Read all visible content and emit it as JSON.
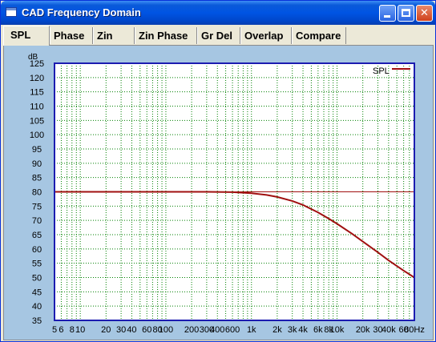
{
  "window": {
    "title": "CAD Frequency Domain"
  },
  "title_buttons": {
    "minimize": "",
    "maximize": "",
    "close": "✕"
  },
  "tabs": [
    {
      "label": "SPL"
    },
    {
      "label": "Phase"
    },
    {
      "label": "Zin"
    },
    {
      "label": "Zin Phase"
    },
    {
      "label": "Gr Del"
    },
    {
      "label": "Overlap"
    },
    {
      "label": "Compare"
    }
  ],
  "colors": {
    "curve": "#a01010",
    "grid": "#008000",
    "frame": "#1c1cb0",
    "plot_bg": "#ffffff",
    "panel_bg": "#a6c6e2"
  },
  "chart_data": {
    "type": "line",
    "ylabel": "dB",
    "ylim": [
      35,
      125
    ],
    "yticks": [
      125,
      120,
      115,
      110,
      105,
      100,
      95,
      90,
      85,
      80,
      75,
      70,
      65,
      60,
      55,
      50,
      45,
      40,
      35
    ],
    "xscale": "log",
    "xlim": [
      5,
      80000
    ],
    "xticks": [
      {
        "value": 5,
        "label": "5"
      },
      {
        "value": 6,
        "label": "6"
      },
      {
        "value": 8,
        "label": "8"
      },
      {
        "value": 10,
        "label": "10"
      },
      {
        "value": 20,
        "label": "20"
      },
      {
        "value": 30,
        "label": "30"
      },
      {
        "value": 40,
        "label": "40"
      },
      {
        "value": 60,
        "label": "60"
      },
      {
        "value": 80,
        "label": "80"
      },
      {
        "value": 100,
        "label": "100"
      },
      {
        "value": 200,
        "label": "200"
      },
      {
        "value": 300,
        "label": "300"
      },
      {
        "value": 400,
        "label": "400"
      },
      {
        "value": 600,
        "label": "600"
      },
      {
        "value": 1000,
        "label": "1k"
      },
      {
        "value": 2000,
        "label": "2k"
      },
      {
        "value": 3000,
        "label": "3k"
      },
      {
        "value": 4000,
        "label": "4k"
      },
      {
        "value": 6000,
        "label": "6k"
      },
      {
        "value": 8000,
        "label": "8k"
      },
      {
        "value": 10000,
        "label": "10k"
      },
      {
        "value": 20000,
        "label": "20k"
      },
      {
        "value": 30000,
        "label": "30"
      },
      {
        "value": 40000,
        "label": "40k"
      },
      {
        "value": 60000,
        "label": "60"
      },
      {
        "value": 80000,
        "label": "80Hz"
      }
    ],
    "reference_line": 80,
    "grid": true,
    "legend": {
      "label": "SPL",
      "position": "top-right"
    },
    "series": [
      {
        "name": "SPL",
        "x": [
          5,
          10,
          50,
          100,
          300,
          600,
          1000,
          1500,
          2000,
          3000,
          4000,
          6000,
          8000,
          10000,
          15000,
          20000,
          30000,
          40000,
          60000,
          80000
        ],
        "y": [
          80,
          80,
          80,
          80,
          80,
          79.9,
          79.5,
          78.9,
          78.2,
          76.8,
          75.4,
          72.8,
          70.6,
          68.8,
          65.3,
          62.6,
          58.8,
          56.0,
          52.4,
          50.0
        ]
      }
    ]
  }
}
